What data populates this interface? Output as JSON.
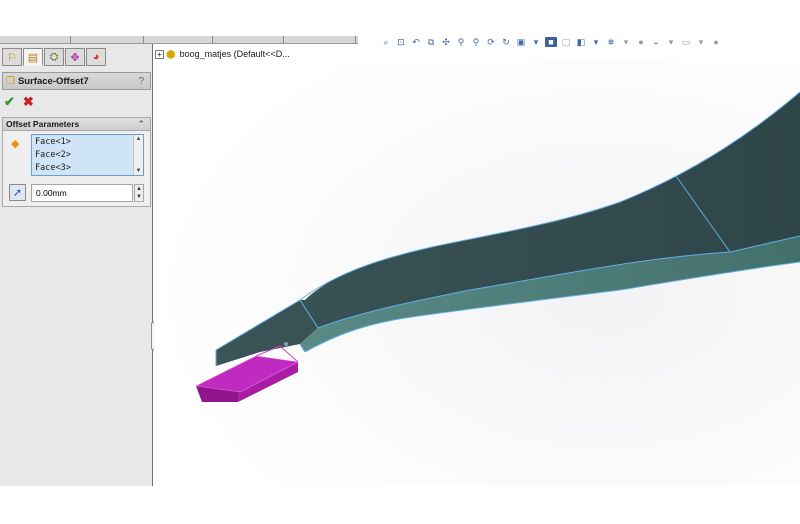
{
  "feature_tree": {
    "part_name": "boog_matjes",
    "config": "(Default<<D..."
  },
  "property_manager": {
    "title": "Surface-Offset7",
    "help": "?",
    "ok_symbol": "✔",
    "cancel_symbol": "✖",
    "offset_parameters": {
      "title": "Offset Parameters",
      "faces": [
        "Face<1>",
        "Face<2>",
        "Face<3>"
      ],
      "distance_value": "0.00mm"
    }
  },
  "manager_tabs": [
    "feature-manager",
    "property-manager",
    "configuration-manager",
    "dimxpert-manager",
    "display-manager"
  ],
  "colors": {
    "panel_bg": "#e8e8e8",
    "surface_top": "#324a4e",
    "surface_side": "#4a7470",
    "surface_edge": "#5fb0e6",
    "offset_surface": "#b516b2",
    "selection_list": "#cfe4f7"
  }
}
